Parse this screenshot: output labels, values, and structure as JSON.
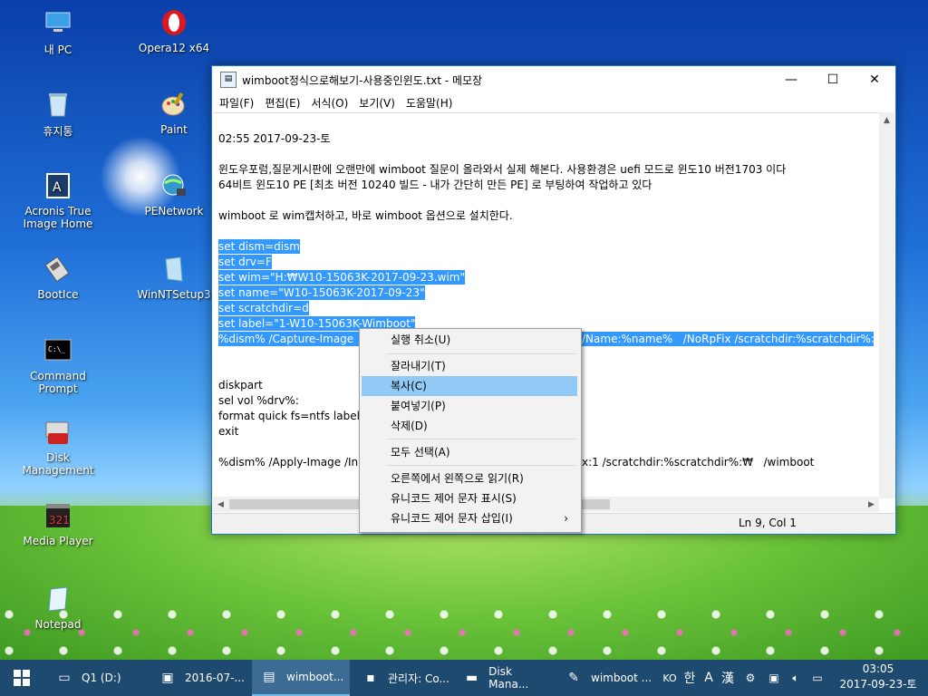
{
  "desktop": {
    "icons": [
      {
        "label": "내 PC",
        "icon": "computer-icon"
      },
      {
        "label": "Opera12 x64",
        "icon": "opera-icon"
      },
      {
        "label": "휴지통",
        "icon": "recycle-bin-icon"
      },
      {
        "label": "Paint",
        "icon": "paint-icon"
      },
      {
        "label": "Acronis True Image Home",
        "icon": "acronis-icon"
      },
      {
        "label": "PENetwork",
        "icon": "network-globe-icon"
      },
      {
        "label": "BootIce",
        "icon": "bootice-icon"
      },
      {
        "label": "WinNTSetup3",
        "icon": "winntsetup-icon"
      },
      {
        "label": "Command Prompt",
        "icon": "cmd-icon"
      },
      {
        "label": "Disk Management",
        "icon": "disk-management-icon"
      },
      {
        "label": "Media Player",
        "icon": "media-player-icon"
      },
      {
        "label": "Notepad",
        "icon": "notepad-icon"
      }
    ]
  },
  "notepad": {
    "title": "wimboot정식으로해보기-사용중인윈도.txt - 메모장",
    "menu": [
      "파일(F)",
      "편집(E)",
      "서식(O)",
      "보기(V)",
      "도움말(H)"
    ],
    "lines": [
      "02:55 2017-09-23-토",
      "윈도우포럼,질문게시판에 오랜만에 wimboot 질문이 올라와서 실제 해본다. 사용환경은 uefi 모드로 윈도10 버전1703 이다",
      "64비트 윈도10 PE [최초 버전 10240 빌드 - 내가 간단히 만든 PE] 로 부팅하여 작업하고 있다",
      "wimboot 로 wim캡처하고, 바로 wimboot 옵션으로 설치한다.",
      "set dism=dism",
      "set drv=F",
      "set wim=\"H:₩W10-15063K-2017-09-23.wim\"",
      "set name=\"W10-15063K-2017-09-23\"",
      "set scratchdir=d",
      "set label=\"1-W10-15063K-Wimboot\"",
      "%dism% /Capture-Image",
      "/Name:%name%   /NoRpFix /scratchdir:%scratchdir%:₩",
      "diskpart",
      "sel vol %drv%:",
      "format quick fs=ntfs label",
      "exit",
      "%dism% /Apply-Image /In",
      "x:1 /scratchdir:%scratchdir%:₩   /wimboot"
    ],
    "status": "Ln 9, Col 1"
  },
  "context_menu": {
    "items": [
      {
        "label": "실행 취소(U)"
      },
      {
        "label": "잘라내기(T)"
      },
      {
        "label": "복사(C)"
      },
      {
        "label": "붙여넣기(P)"
      },
      {
        "label": "삭제(D)"
      },
      {
        "label": "모두 선택(A)"
      },
      {
        "label": "오른쪽에서 왼쪽으로 읽기(R)"
      },
      {
        "label": "유니코드 제어 문자 표시(S)"
      },
      {
        "label": "유니코드 제어 문자 삽입(I)"
      }
    ],
    "highlighted": "복사(C)"
  },
  "taskbar": {
    "items": [
      {
        "label": "Q1 (D:)",
        "icon": "drive-icon"
      },
      {
        "label": "2016-07-...",
        "icon": "media-player-icon"
      },
      {
        "label": "wimboot...",
        "icon": "notepad-icon"
      },
      {
        "label": "관리자: Co...",
        "icon": "cmd-icon"
      },
      {
        "label": "Disk Mana...",
        "icon": "disk-management-icon"
      },
      {
        "label": "wimboot ...",
        "icon": "paint-icon"
      }
    ],
    "tray": {
      "ime_lang": "KO",
      "ime_mode": "한",
      "ime_a": "A",
      "ime_hanja": "漢"
    },
    "time": "03:05",
    "date": "2017-09-23-토"
  }
}
